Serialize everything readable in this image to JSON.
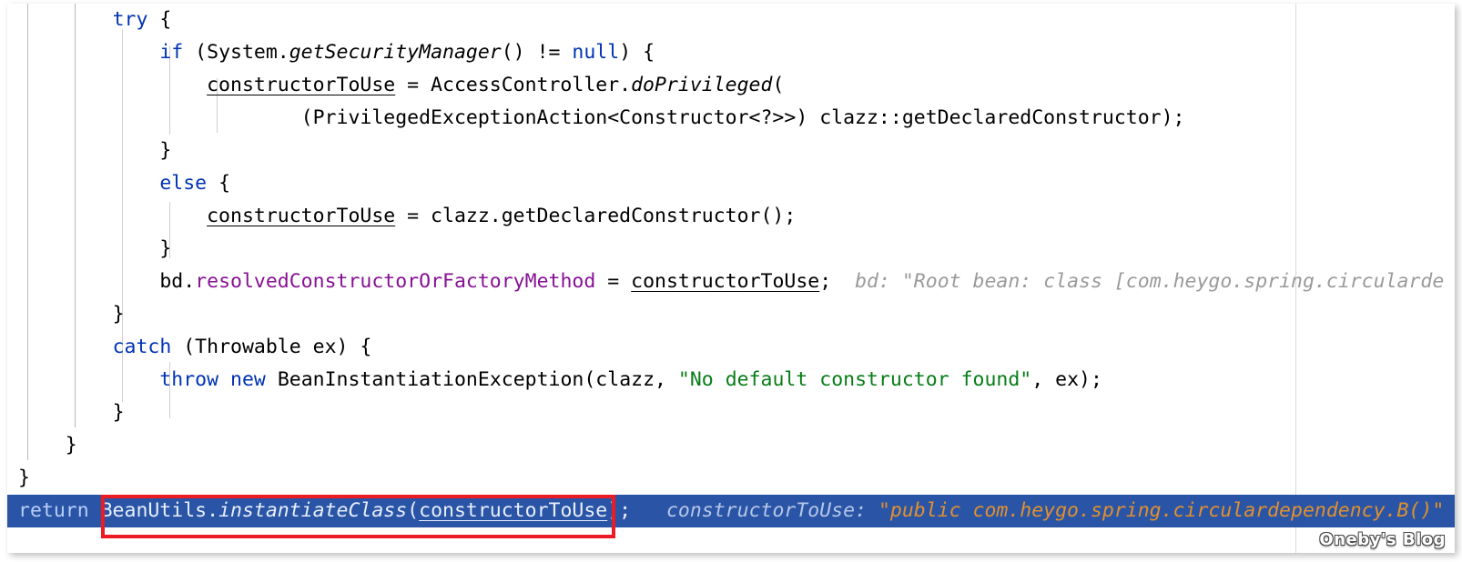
{
  "editor": {
    "language": "java",
    "theme": "IntelliJ Light",
    "colors": {
      "background": "#ffffff",
      "selection": "#2a55a6",
      "keyword": "#0033b3",
      "string": "#067d17",
      "field": "#871094",
      "hint": "#9a9a9a",
      "hint_value": "#e08c28",
      "indent_guide": "#cfcfcf",
      "annotation": "#ec1c24"
    },
    "lines": [
      {
        "id": "line-try",
        "indent": "        ",
        "tokens": [
          {
            "text": "try",
            "style": "kw"
          },
          {
            "text": " {",
            "style": "ident"
          }
        ]
      },
      {
        "id": "line-if-security-manager",
        "indent": "            ",
        "tokens": [
          {
            "text": "if",
            "style": "kw"
          },
          {
            "text": " (System.",
            "style": "ident"
          },
          {
            "text": "getSecurityManager",
            "style": "method"
          },
          {
            "text": "() != ",
            "style": "ident"
          },
          {
            "text": "null",
            "style": "kw"
          },
          {
            "text": ") {",
            "style": "ident"
          }
        ]
      },
      {
        "id": "line-do-privileged",
        "indent": "                ",
        "tokens": [
          {
            "text": "constructorToUse",
            "style": "ident underl"
          },
          {
            "text": " = AccessController.",
            "style": "ident"
          },
          {
            "text": "doPrivileged",
            "style": "method"
          },
          {
            "text": "(",
            "style": "ident"
          }
        ]
      },
      {
        "id": "line-privileged-action",
        "indent": "                        ",
        "tokens": [
          {
            "text": "(PrivilegedExceptionAction<Constructor<?>>) clazz::getDeclaredConstructor);",
            "style": "ident"
          }
        ]
      },
      {
        "id": "line-close-if",
        "indent": "            ",
        "tokens": [
          {
            "text": "}",
            "style": "ident"
          }
        ]
      },
      {
        "id": "line-else",
        "indent": "            ",
        "tokens": [
          {
            "text": "else",
            "style": "kw"
          },
          {
            "text": " {",
            "style": "ident"
          }
        ]
      },
      {
        "id": "line-get-declared-constructor",
        "indent": "                ",
        "tokens": [
          {
            "text": "constructorToUse",
            "style": "ident underl"
          },
          {
            "text": " = clazz.getDeclaredConstructor();",
            "style": "ident"
          }
        ]
      },
      {
        "id": "line-close-else",
        "indent": "            ",
        "tokens": [
          {
            "text": "}",
            "style": "ident"
          }
        ]
      },
      {
        "id": "line-resolved-constructor",
        "indent": "            ",
        "tokens": [
          {
            "text": "bd.",
            "style": "ident"
          },
          {
            "text": "resolvedConstructorOrFactoryMethod",
            "style": "field"
          },
          {
            "text": " = ",
            "style": "ident"
          },
          {
            "text": "constructorToUse",
            "style": "ident underl"
          },
          {
            "text": ";",
            "style": "ident"
          },
          {
            "text": "  bd: \"Root bean: class [com.heygo.spring.circularde",
            "style": "hint"
          }
        ]
      },
      {
        "id": "line-close-try",
        "indent": "        ",
        "tokens": [
          {
            "text": "}",
            "style": "ident"
          }
        ]
      },
      {
        "id": "line-catch",
        "indent": "        ",
        "tokens": [
          {
            "text": "catch",
            "style": "kw"
          },
          {
            "text": " (Throwable ex) {",
            "style": "ident"
          }
        ]
      },
      {
        "id": "line-throw",
        "indent": "            ",
        "tokens": [
          {
            "text": "throw",
            "style": "kw"
          },
          {
            "text": " ",
            "style": "ident"
          },
          {
            "text": "new",
            "style": "kw"
          },
          {
            "text": " BeanInstantiationException(clazz, ",
            "style": "ident"
          },
          {
            "text": "\"No default constructor found\"",
            "style": "str"
          },
          {
            "text": ", ex);",
            "style": "ident"
          }
        ]
      },
      {
        "id": "line-close-catch",
        "indent": "        ",
        "tokens": [
          {
            "text": "}",
            "style": "ident"
          }
        ]
      },
      {
        "id": "line-close-method",
        "indent": "    ",
        "tokens": [
          {
            "text": "}",
            "style": "ident"
          }
        ]
      },
      {
        "id": "line-close-block",
        "indent": "",
        "tokens": [
          {
            "text": "}",
            "style": "ident"
          }
        ]
      },
      {
        "id": "line-return-selected",
        "selected": true,
        "indent": "",
        "tokens": [
          {
            "text": "return",
            "style": "kw"
          },
          {
            "text": " BeanUtils.",
            "style": "ident"
          },
          {
            "text": "instantiateClass",
            "style": "method"
          },
          {
            "text": "(",
            "style": "ident"
          },
          {
            "text": "constructorToUse",
            "style": "ident underl"
          },
          {
            "text": ");",
            "style": "ident"
          },
          {
            "text": "   constructorToUse: ",
            "style": "hint"
          },
          {
            "text": "\"public com.heygo.spring.circulardependency.B()\"",
            "style": "hint-val-orange"
          }
        ]
      }
    ]
  },
  "annotation": {
    "label": "highlighted-return-expression",
    "color": "#ec1c24"
  },
  "watermark": {
    "text": "Oneby's Blog"
  }
}
